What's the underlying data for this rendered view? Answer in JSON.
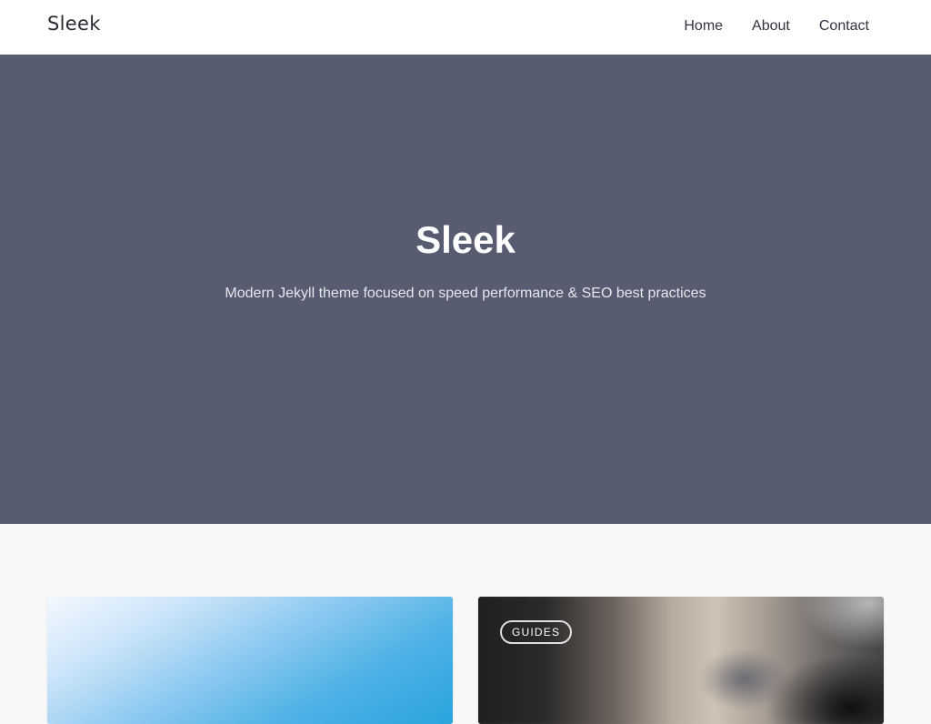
{
  "navbar": {
    "brand": "Sleek",
    "links": [
      {
        "label": "Home"
      },
      {
        "label": "About"
      },
      {
        "label": "Contact"
      }
    ]
  },
  "hero": {
    "title": "Sleek",
    "subtitle": "Modern Jekyll theme focused on speed performance & SEO best practices",
    "background_color": "#575c70"
  },
  "posts": [
    {
      "tag": ""
    },
    {
      "tag": "Guides"
    }
  ],
  "colors": {
    "page_background": "#f8f8f8",
    "navbar_background": "#ffffff",
    "text_dark": "#2b2b33"
  }
}
